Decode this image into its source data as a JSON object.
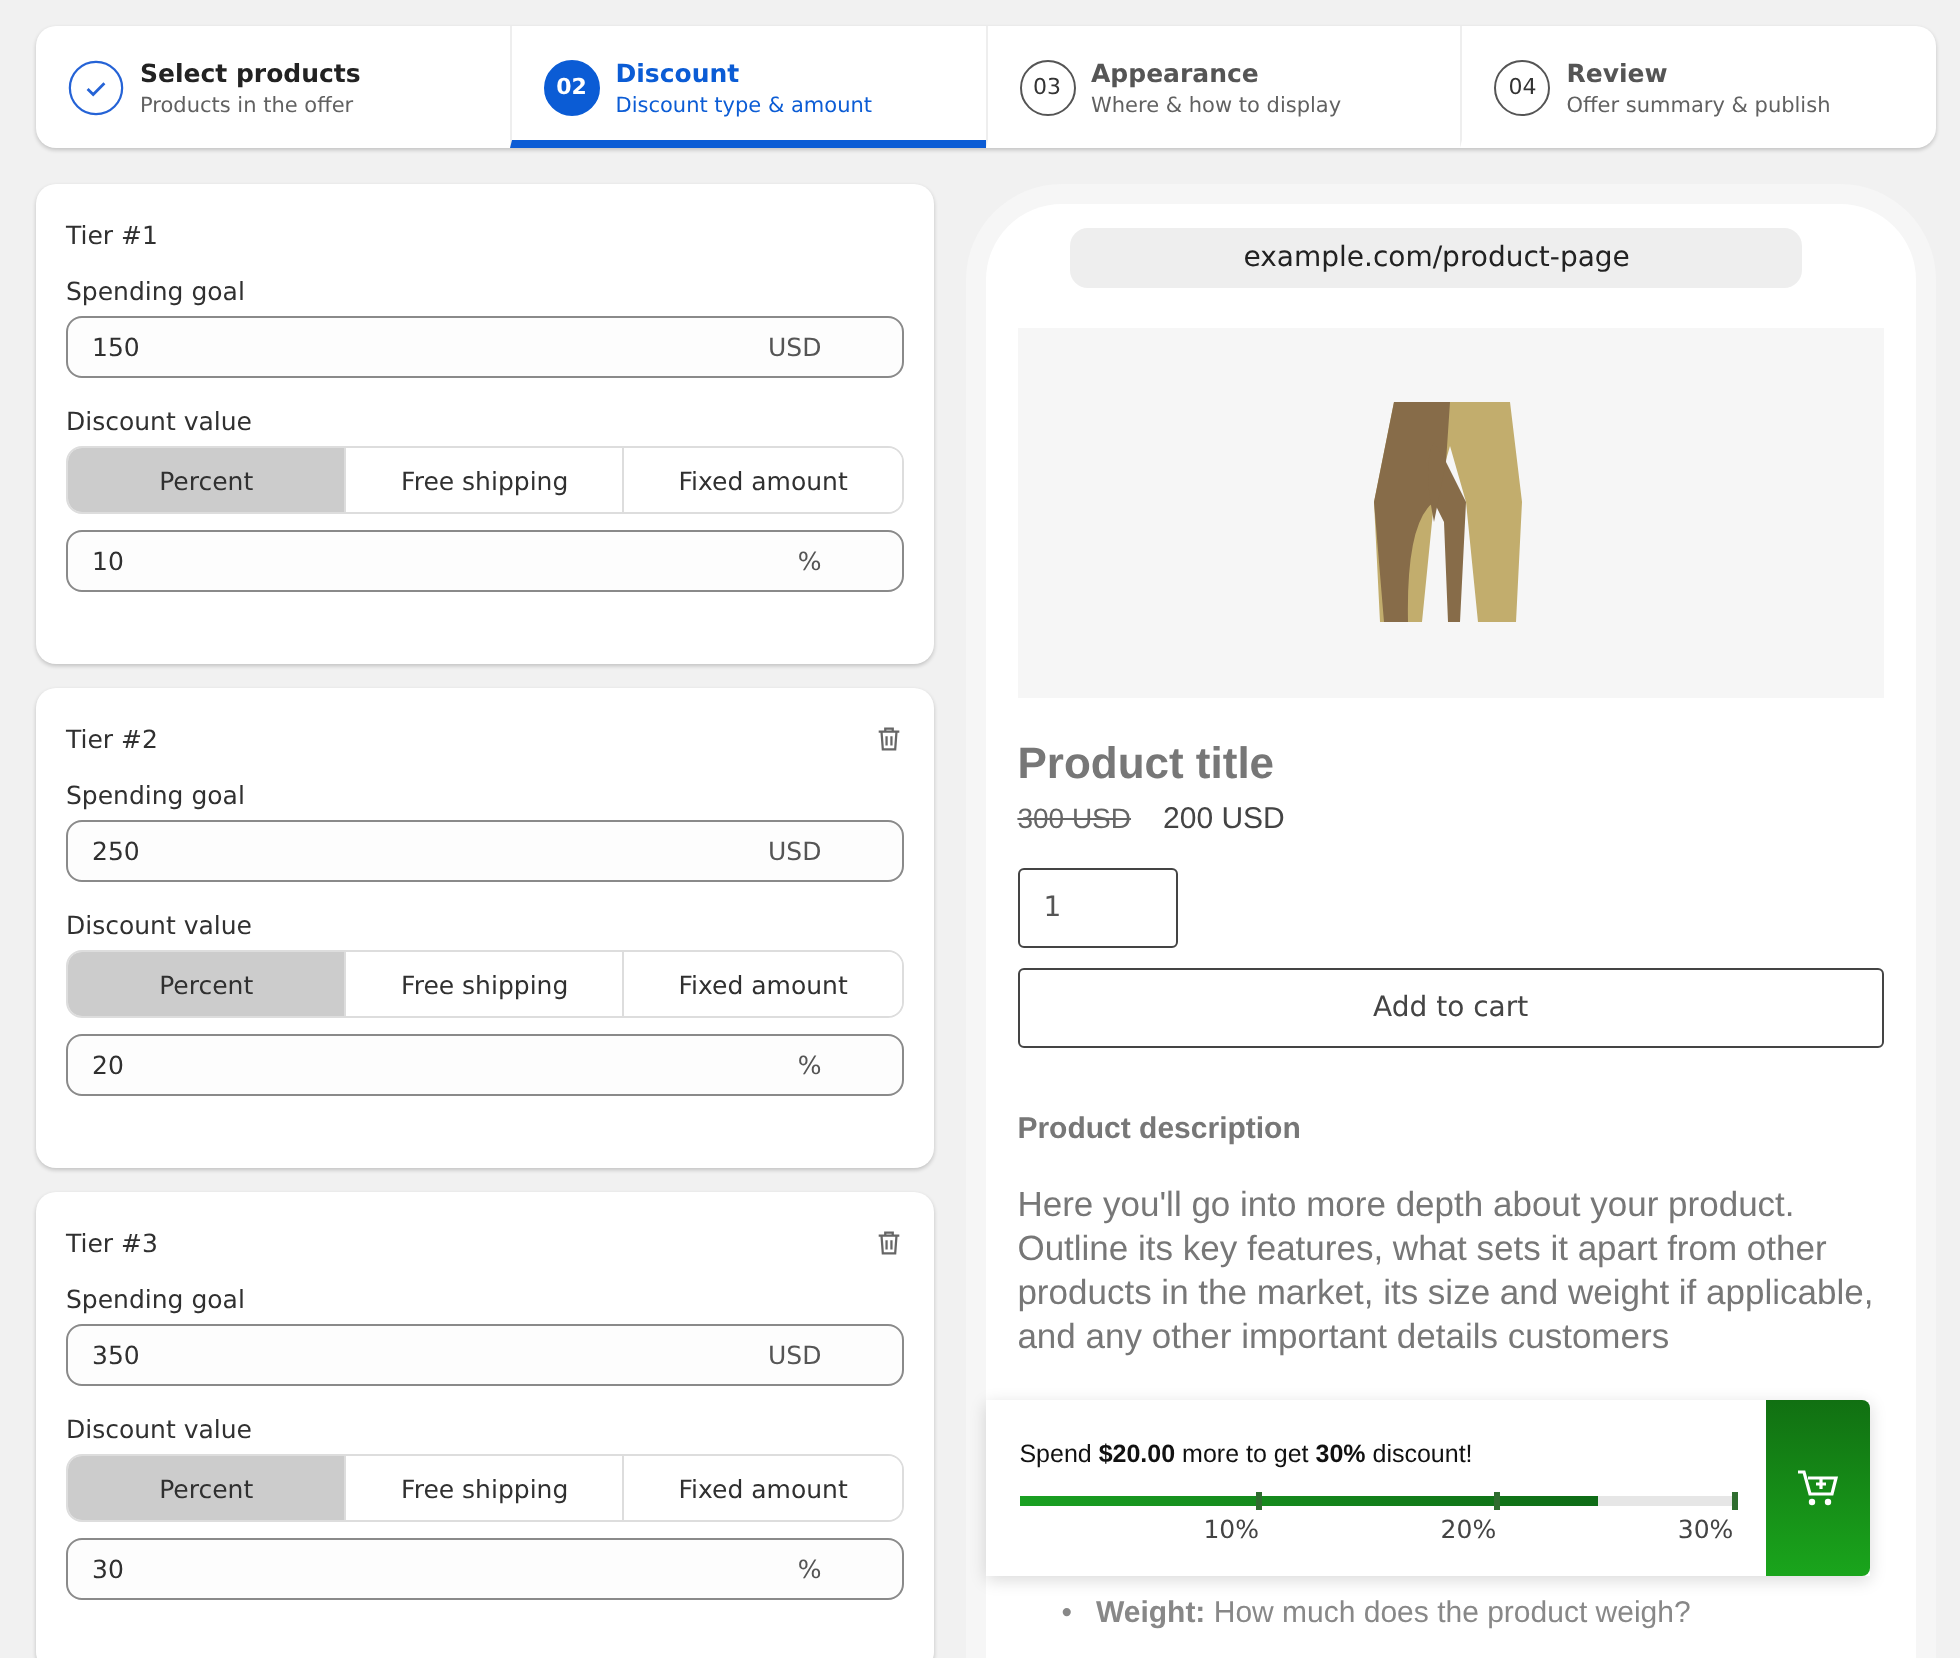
{
  "steps": [
    {
      "title": "Select products",
      "subtitle": "Products in the offer",
      "done": true,
      "selected": false
    },
    {
      "number": "02",
      "title": "Discount",
      "subtitle": "Discount type & amount",
      "done": false,
      "selected": true
    },
    {
      "number": "03",
      "title": "Appearance",
      "subtitle": "Where & how to display",
      "done": false,
      "selected": false
    },
    {
      "number": "04",
      "title": "Review",
      "subtitle": "Offer summary & publish",
      "done": false,
      "selected": false
    }
  ],
  "tiers": [
    {
      "title": "Tier #1",
      "removable": false,
      "goal_label": "Spending goal",
      "goal": "150",
      "goal_suffix": "USD",
      "discount_label": "Discount value",
      "options": [
        {
          "label": "Percent",
          "selected": true
        },
        {
          "label": "Free shipping",
          "selected": false
        },
        {
          "label": "Fixed amount",
          "selected": false
        }
      ],
      "value": "10",
      "value_suffix": "%"
    },
    {
      "title": "Tier #2",
      "removable": true,
      "goal_label": "Spending goal",
      "goal": "250",
      "goal_suffix": "USD",
      "discount_label": "Discount value",
      "options": [
        {
          "label": "Percent",
          "selected": true
        },
        {
          "label": "Free shipping",
          "selected": false
        },
        {
          "label": "Fixed amount",
          "selected": false
        }
      ],
      "value": "20",
      "value_suffix": "%"
    },
    {
      "title": "Tier #3",
      "removable": true,
      "goal_label": "Spending goal",
      "goal": "350",
      "goal_suffix": "USD",
      "discount_label": "Discount value",
      "options": [
        {
          "label": "Percent",
          "selected": true
        },
        {
          "label": "Free shipping",
          "selected": false
        },
        {
          "label": "Fixed amount",
          "selected": false
        }
      ],
      "value": "30",
      "value_suffix": "%"
    }
  ],
  "preview": {
    "url": "example.com/product-page",
    "product_title": "Product title",
    "old_price": "300 USD",
    "price": "200 USD",
    "quantity": "1",
    "add_to_cart": "Add to cart",
    "description_heading": "Product description",
    "description": "Here you'll go into more depth about your product. Outline its key features, what sets it apart from other products in the market, its size and weight if applicable, and any other important details customers",
    "bullet_marker": "•",
    "bullet": "**Weight:** How much does the product weigh?",
    "banner": {
      "message": "Spend **$20.00** more to get **30%** discount!",
      "level": 0.81,
      "ticks": [
        "10%",
        "20%",
        "30%"
      ]
    }
  }
}
